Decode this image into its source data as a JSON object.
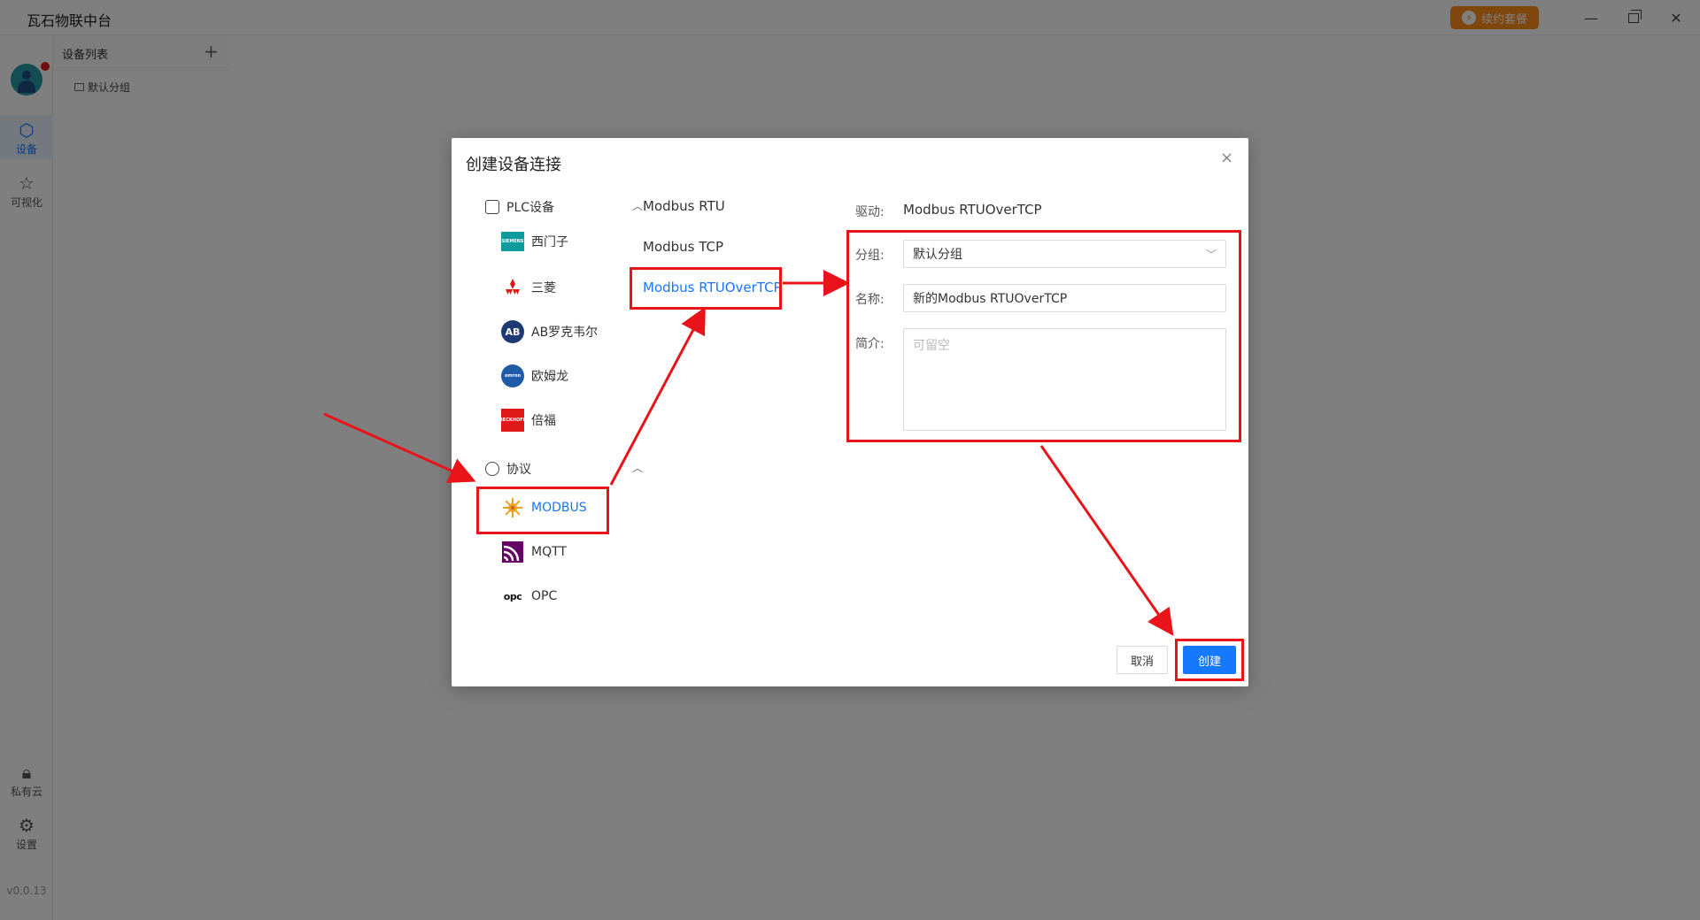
{
  "app": {
    "title": "瓦石物联中台",
    "upgrade_label": "续约套餐",
    "version": "v0.0.13"
  },
  "rail": {
    "devices_label": "设备",
    "visual_label": "可视化",
    "private_cloud_label": "私有云",
    "settings_label": "设置"
  },
  "device_list": {
    "title": "设备列表",
    "add_symbol": "+",
    "default_group": "默认分组"
  },
  "modal": {
    "title": "创建设备连接",
    "close_symbol": "×",
    "categories": {
      "plc": {
        "label": "PLC设备",
        "items": [
          {
            "label": "西门子",
            "logo_text": "SIEMENS"
          },
          {
            "label": "三菱",
            "logo_text": ""
          },
          {
            "label": "AB罗克韦尔",
            "logo_text": "AB"
          },
          {
            "label": "欧姆龙",
            "logo_text": "omron"
          },
          {
            "label": "倍福",
            "logo_text": "BECKHOFF"
          }
        ]
      },
      "protocol": {
        "label": "协议",
        "items": [
          {
            "label": "MODBUS"
          },
          {
            "label": "MQTT"
          },
          {
            "label": "OPC",
            "logo_text": "opc"
          }
        ]
      }
    },
    "protocols": [
      {
        "label": "Modbus RTU"
      },
      {
        "label": "Modbus TCP"
      },
      {
        "label": "Modbus RTUOverTCP"
      }
    ],
    "form": {
      "driver_label": "驱动:",
      "driver_value": "Modbus RTUOverTCP",
      "group_label": "分组:",
      "group_value": "默认分组",
      "name_label": "名称:",
      "name_value": "新的Modbus RTUOverTCP",
      "desc_label": "简介:",
      "desc_placeholder": "可留空"
    },
    "buttons": {
      "cancel": "取消",
      "create": "创建"
    }
  },
  "colors": {
    "accent": "#1677ff",
    "annotation_red": "#e8141a",
    "upgrade_orange": "#ff8c1a"
  }
}
